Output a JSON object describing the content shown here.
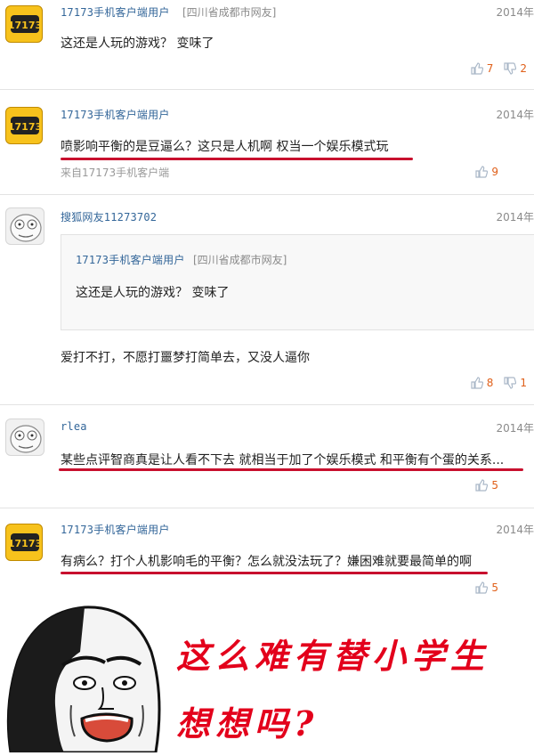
{
  "comments": [
    {
      "user": "17173手机客户端用户",
      "location": "[四川省成都市网友]",
      "date": "2014年",
      "text": "这还是人玩的游戏？ 变味了",
      "up": "7",
      "down": "2"
    },
    {
      "user": "17173手机客户端用户",
      "date": "2014年",
      "text": "喷影响平衡的是豆逼么？这只是人机啊 权当一个娱乐模式玩",
      "source": "来自17173手机客户端",
      "up": "9"
    },
    {
      "user": "搜狐网友11273702",
      "date": "2014年",
      "quote": {
        "user": "17173手机客户端用户",
        "location": "[四川省成都市网友]",
        "text": "这还是人玩的游戏？ 变味了"
      },
      "text": "爱打不打，不愿打噩梦打简单去，又没人逼你",
      "up": "8",
      "down": "1"
    },
    {
      "user": "rlea",
      "date": "2014年",
      "text": "某些点评智商真是让人看不下去 就相当于加了个娱乐模式 和平衡有个蛋的关系...",
      "up": "5"
    },
    {
      "user": "17173手机客户端用户",
      "date": "2014年",
      "text": "有病么？打个人机影响毛的平衡？怎么就没法玩了？嫌困难就要最简单的啊",
      "up": "5"
    }
  ],
  "meme": {
    "line1": "这么难有替小学生",
    "line2": "想想吗?"
  },
  "colors": {
    "accent": "#e0601a",
    "underline": "#c8102e",
    "meme": "#e3001b",
    "username": "#336699"
  },
  "icons": {
    "up": "thumbs-up-icon",
    "down": "thumbs-down-icon",
    "avatar1": "17173-logo-avatar",
    "avatar2": "rage-face-avatar"
  }
}
